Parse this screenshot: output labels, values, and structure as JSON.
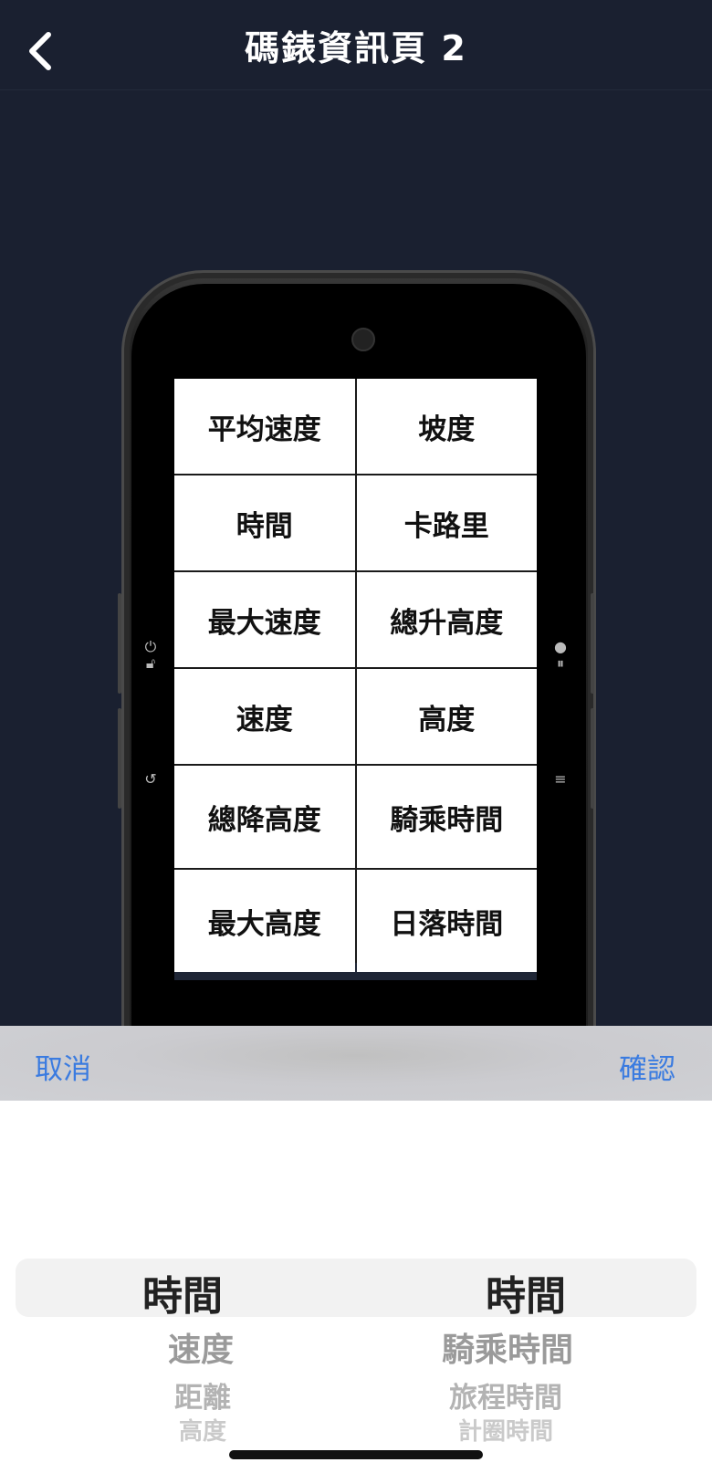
{
  "nav": {
    "title": "碼錶資訊頁 2"
  },
  "fields": [
    [
      "平均速度",
      "坡度"
    ],
    [
      "時間",
      "卡路里"
    ],
    [
      "最大速度",
      "總升高度"
    ],
    [
      "速度",
      "高度"
    ],
    [
      "總降高度",
      "騎乘時間"
    ],
    [
      "最大高度",
      "日落時間"
    ]
  ],
  "toolbar": {
    "cancel_label": "取消",
    "confirm_label": "確認"
  },
  "picker": {
    "left": {
      "selected": "時間",
      "below": [
        "速度",
        "距離",
        "高度"
      ]
    },
    "right": {
      "selected": "時間",
      "below": [
        "騎乘時間",
        "旅程時間",
        "計圈時間"
      ]
    }
  },
  "colors": {
    "background": "#1a2030",
    "accent": "#3a7be0"
  }
}
